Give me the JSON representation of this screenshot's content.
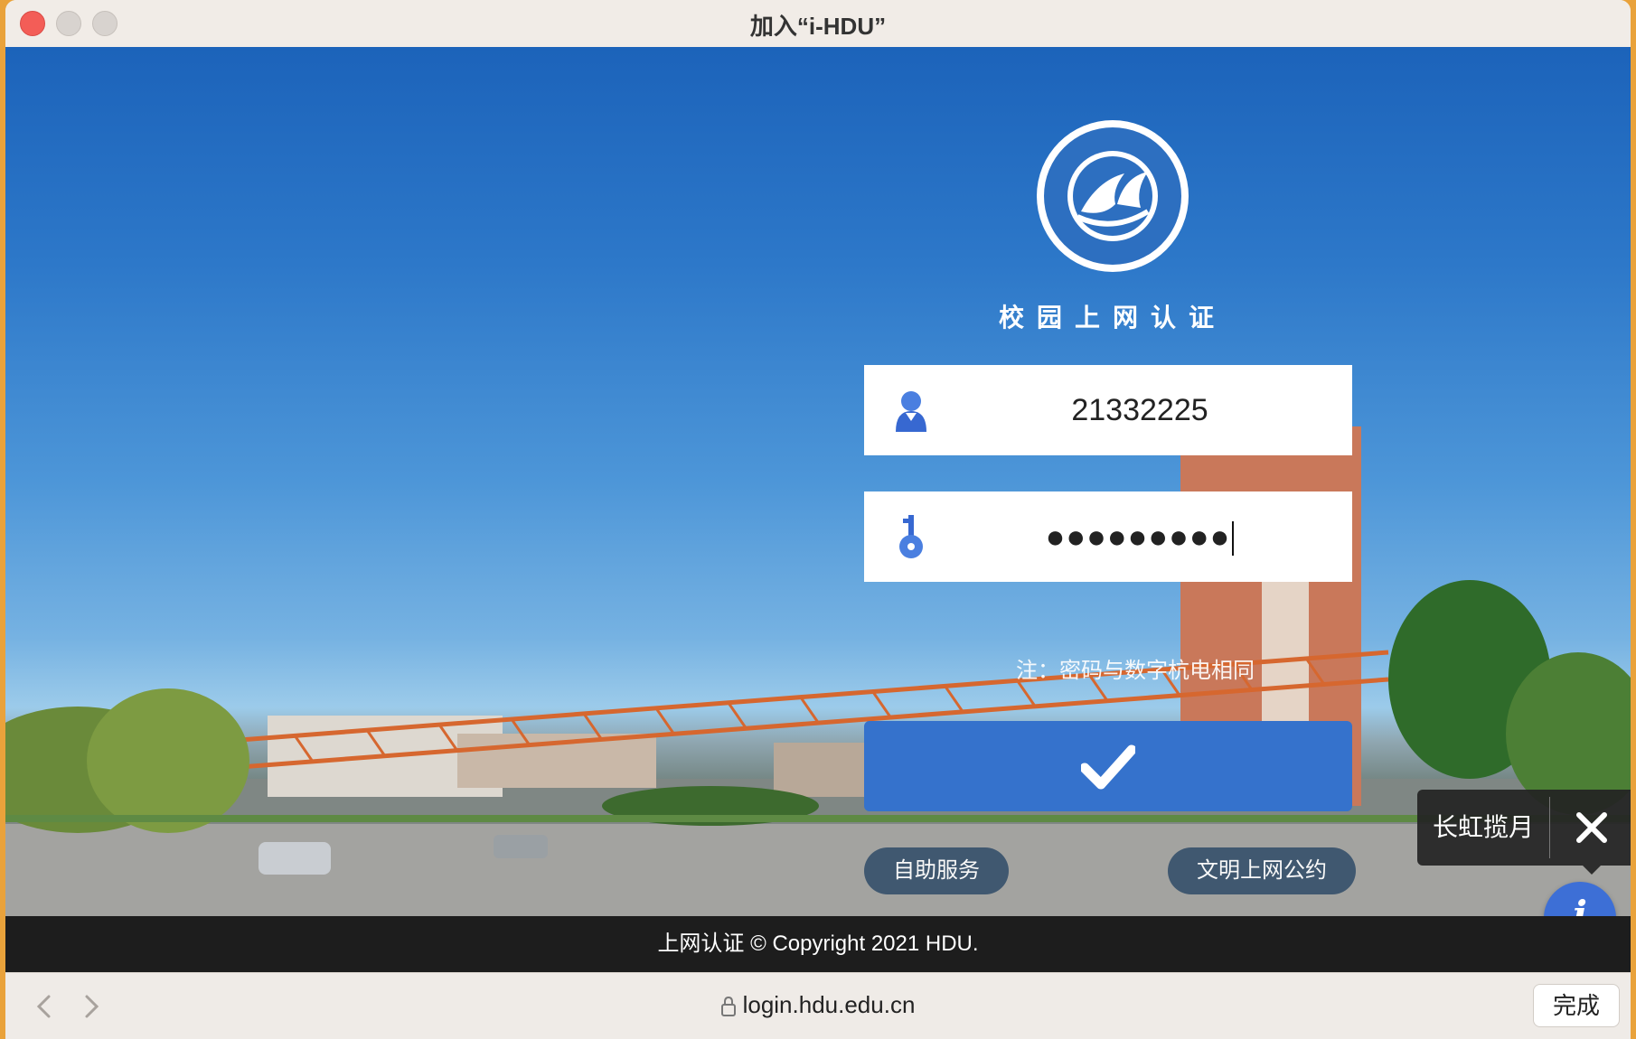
{
  "window": {
    "title": "加入“i-HDU”"
  },
  "portal": {
    "heading": "校园上网认证",
    "username_value": "21332225",
    "password_mask": "●●●●●●●●●",
    "note": "注：密码与数字杭电相同",
    "self_service_label": "自助服务",
    "rules_label": "文明上网公约"
  },
  "tooltip": {
    "label": "长虹揽月"
  },
  "info_button": {
    "glyph": "i"
  },
  "footer": {
    "text": "上网认证 © Copyright 2021 HDU."
  },
  "browser": {
    "url": "login.hdu.edu.cn",
    "done_label": "完成"
  },
  "colors": {
    "accent": "#3572cc",
    "pill": "#39536d",
    "info": "#3d6fd6",
    "footer": "#1d1d1d"
  }
}
